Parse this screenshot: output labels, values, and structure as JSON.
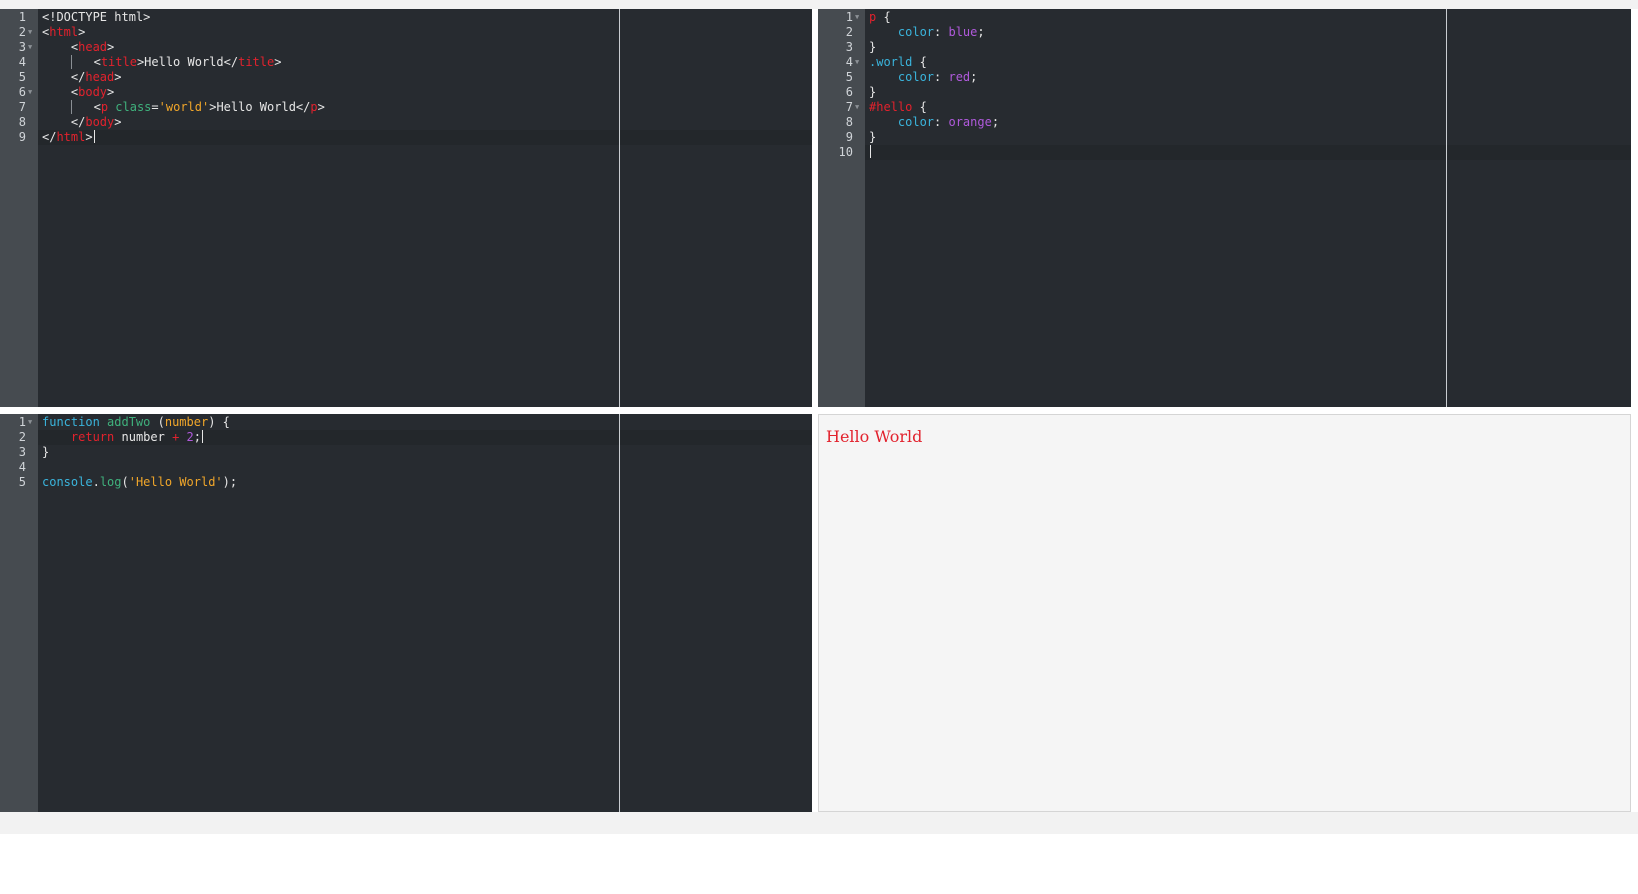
{
  "colors": {
    "editor_background": "#272b30",
    "gutter_background": "#464b50",
    "preview_background": "#f5f5f5",
    "preview_text": "#e2222d"
  },
  "html_editor": {
    "lines": [
      {
        "number": "1",
        "fold": false,
        "tokens": [
          [
            "plain",
            "<!DOCTYPE html>"
          ]
        ]
      },
      {
        "number": "2",
        "fold": true,
        "tokens": [
          [
            "plain",
            "<"
          ],
          [
            "tag",
            "html"
          ],
          [
            "plain",
            ">"
          ]
        ]
      },
      {
        "number": "3",
        "fold": true,
        "tokens": [
          [
            "plain",
            "    <"
          ],
          [
            "tag",
            "head"
          ],
          [
            "plain",
            ">"
          ]
        ]
      },
      {
        "number": "4",
        "fold": false,
        "guide": 1,
        "tokens": [
          [
            "plain",
            "    <"
          ],
          [
            "tag",
            "title"
          ],
          [
            "plain",
            ">Hello World</"
          ],
          [
            "tag",
            "title"
          ],
          [
            "plain",
            ">"
          ]
        ]
      },
      {
        "number": "5",
        "fold": false,
        "tokens": [
          [
            "plain",
            "    </"
          ],
          [
            "tag",
            "head"
          ],
          [
            "plain",
            ">"
          ]
        ]
      },
      {
        "number": "6",
        "fold": true,
        "tokens": [
          [
            "plain",
            "    <"
          ],
          [
            "tag",
            "body"
          ],
          [
            "plain",
            ">"
          ]
        ]
      },
      {
        "number": "7",
        "fold": false,
        "guide": 1,
        "tokens": [
          [
            "plain",
            "    <"
          ],
          [
            "tag",
            "p"
          ],
          [
            "plain",
            " "
          ],
          [
            "attr",
            "class"
          ],
          [
            "plain",
            "="
          ],
          [
            "string",
            "'world'"
          ],
          [
            "plain",
            ">Hello World</"
          ],
          [
            "tag",
            "p"
          ],
          [
            "plain",
            ">"
          ]
        ]
      },
      {
        "number": "8",
        "fold": false,
        "tokens": [
          [
            "plain",
            "    </"
          ],
          [
            "tag",
            "body"
          ],
          [
            "plain",
            ">"
          ]
        ]
      },
      {
        "number": "9",
        "fold": false,
        "active": true,
        "cursor": true,
        "tokens": [
          [
            "plain",
            "</"
          ],
          [
            "tag",
            "html"
          ],
          [
            "plain",
            ">"
          ]
        ]
      }
    ]
  },
  "css_editor": {
    "lines": [
      {
        "number": "1",
        "fold": true,
        "tokens": [
          [
            "tag",
            "p"
          ],
          [
            "plain",
            " {"
          ]
        ]
      },
      {
        "number": "2",
        "fold": false,
        "tokens": [
          [
            "plain",
            "    "
          ],
          [
            "prop",
            "color"
          ],
          [
            "plain",
            ": "
          ],
          [
            "value",
            "blue"
          ],
          [
            "plain",
            ";"
          ]
        ]
      },
      {
        "number": "3",
        "fold": false,
        "tokens": [
          [
            "plain",
            "}"
          ]
        ]
      },
      {
        "number": "4",
        "fold": true,
        "tokens": [
          [
            "prop",
            ".world"
          ],
          [
            "plain",
            " {"
          ]
        ]
      },
      {
        "number": "5",
        "fold": false,
        "tokens": [
          [
            "plain",
            "    "
          ],
          [
            "prop",
            "color"
          ],
          [
            "plain",
            ": "
          ],
          [
            "value",
            "red"
          ],
          [
            "plain",
            ";"
          ]
        ]
      },
      {
        "number": "6",
        "fold": false,
        "tokens": [
          [
            "plain",
            "}"
          ]
        ]
      },
      {
        "number": "7",
        "fold": true,
        "tokens": [
          [
            "tag",
            "#hello"
          ],
          [
            "plain",
            " {"
          ]
        ]
      },
      {
        "number": "8",
        "fold": false,
        "tokens": [
          [
            "plain",
            "    "
          ],
          [
            "prop",
            "color"
          ],
          [
            "plain",
            ": "
          ],
          [
            "value",
            "orange"
          ],
          [
            "plain",
            ";"
          ]
        ]
      },
      {
        "number": "9",
        "fold": false,
        "tokens": [
          [
            "plain",
            "}"
          ]
        ]
      },
      {
        "number": "10",
        "fold": false,
        "active": true,
        "cursor": true,
        "tokens": []
      }
    ]
  },
  "js_editor": {
    "lines": [
      {
        "number": "1",
        "fold": true,
        "tokens": [
          [
            "kw",
            "function"
          ],
          [
            "plain",
            " "
          ],
          [
            "fn",
            "addTwo"
          ],
          [
            "plain",
            " ("
          ],
          [
            "param",
            "number"
          ],
          [
            "plain",
            ") {"
          ]
        ]
      },
      {
        "number": "2",
        "fold": false,
        "active": true,
        "cursor": true,
        "tokens": [
          [
            "plain",
            "    "
          ],
          [
            "ret",
            "return"
          ],
          [
            "plain",
            " number "
          ],
          [
            "op",
            "+"
          ],
          [
            "plain",
            " "
          ],
          [
            "num",
            "2"
          ],
          [
            "plain",
            ";"
          ]
        ]
      },
      {
        "number": "3",
        "fold": false,
        "tokens": [
          [
            "plain",
            "}"
          ]
        ]
      },
      {
        "number": "4",
        "fold": false,
        "tokens": []
      },
      {
        "number": "5",
        "fold": false,
        "tokens": [
          [
            "kw",
            "console"
          ],
          [
            "plain",
            "."
          ],
          [
            "method",
            "log"
          ],
          [
            "plain",
            "("
          ],
          [
            "string",
            "'Hello World'"
          ],
          [
            "plain",
            ");"
          ]
        ]
      }
    ]
  },
  "preview": {
    "text": "Hello World"
  }
}
